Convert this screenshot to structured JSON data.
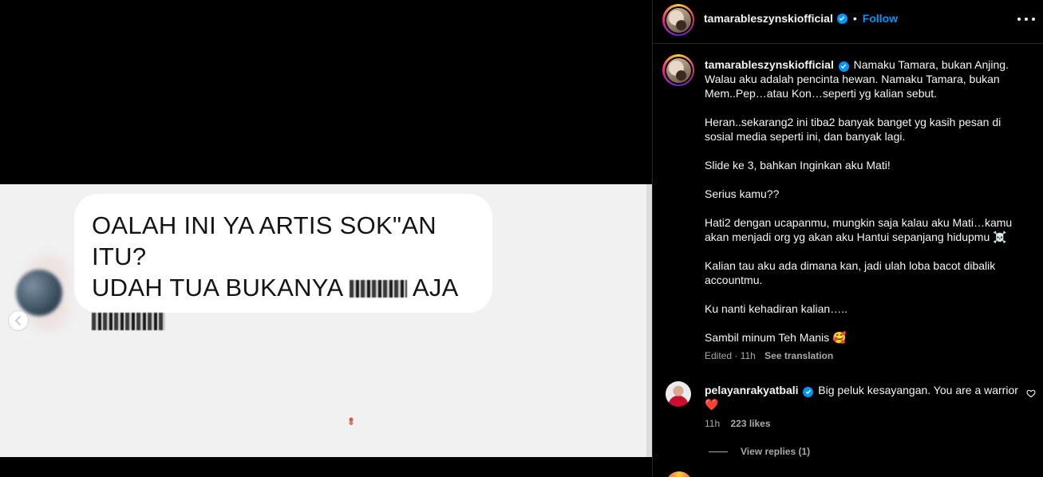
{
  "media": {
    "bubble_line1": "OALAH INI YA ARTIS SOK\"AN ITU?",
    "bubble_line2_a": "UDAH TUA BUKANYA",
    "bubble_line2_b": "AJA",
    "prev_icon": "chevron-left-icon"
  },
  "header": {
    "username": "tamarableszynskiofficial",
    "separator": "•",
    "follow_label": "Follow",
    "more_icon": "more-horizontal-icon"
  },
  "caption": {
    "username": "tamarableszynskiofficial",
    "paragraphs": [
      "Namaku Tamara, bukan Anjing. Walau aku adalah pencinta hewan. Namaku Tamara, bukan Mem..Pep…atau Kon…seperti yg kalian sebut.",
      "Heran..sekarang2 ini tiba2 banyak banget yg kasih pesan di sosial media seperti ini, dan banyak lagi.",
      "Slide ke 3, bahkan Inginkan aku Mati!",
      "Serius kamu??",
      "Hati2 dengan ucapanmu, mungkin saja kalau aku Mati…kamu akan menjadi org yg akan aku Hantui sepanjang hidupmu ☠️",
      "Kalian tau aku ada dimana kan, jadi ulah loba bacot dibalik accountmu.",
      "Ku nanti kehadiran kalian…..",
      "Sambil minum Teh Manis 🥰"
    ],
    "edited": "Edited · 11h",
    "see_translation": "See translation"
  },
  "comment": {
    "username": "pelayanrakyatbali",
    "text": "Big peluk kesayangan. You are a warrior ❤️",
    "time": "11h",
    "likes": "223 likes",
    "view_replies": "View replies (1)"
  },
  "colors": {
    "accent": "#0095f6",
    "background": "#000000",
    "muted": "#a8a8a8"
  }
}
